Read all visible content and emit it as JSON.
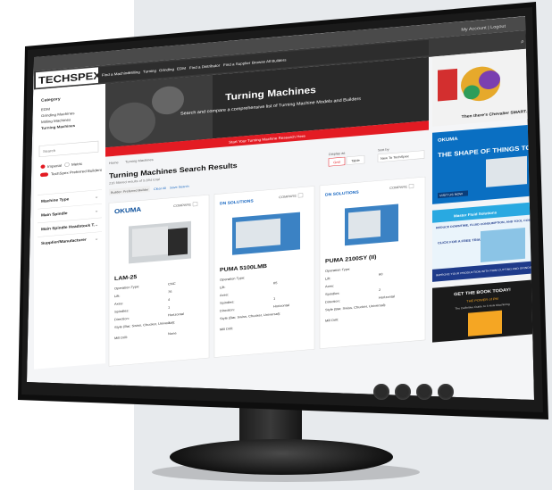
{
  "header": {
    "account_link": "My Account | Logout",
    "logo": "TECHSPEX",
    "nav": [
      "Find a Machine",
      "Milling",
      "Turning",
      "Grinding",
      "EDM",
      "Find a Distributor",
      "Find a Supplier",
      "Browse All Builders"
    ]
  },
  "sidebar": {
    "category_title": "Category",
    "categories": [
      "EDM",
      "Grinding Machines",
      "Milling Machines",
      "Turning Machines"
    ],
    "search_placeholder": "Search",
    "unit_imperial": "Imperial",
    "unit_metric": "Metric",
    "toggle_label": "TechSpex Preferred Builders",
    "filters": [
      "Machine Type",
      "Main Spindle",
      "Main Spindle Headstock T.",
      "Supplier/Manufacturer"
    ]
  },
  "hero": {
    "title": "Turning Machines",
    "subtitle": "Search and compare a comprehensive list of Turning Machine Models and Builders",
    "cta": "Start Your Turning Machine Research Here"
  },
  "breadcrumb": [
    "Home",
    "Turning Machines"
  ],
  "results": {
    "title": "Turning Machines Search Results",
    "count": "216 filtered results of 5,894 total",
    "chip": "Builder: Preferred Builder",
    "clear": "Clear All",
    "save": "Save Search",
    "display_label": "Display as",
    "grid": "Grid",
    "table": "Table",
    "sort_label": "Sort by",
    "sort_value": "New To TechSpex"
  },
  "cards": [
    {
      "brand": "OKUMA",
      "compare": "COMPARE",
      "name": "LAM-25",
      "rows": [
        [
          "Operation Type:",
          "CNC"
        ],
        [
          "Lift:",
          "76"
        ],
        [
          "Axes:",
          "4"
        ],
        [
          "Spindles:",
          "1"
        ],
        [
          "Direction:",
          "Horizontal"
        ],
        [
          "Style (Bar, Swiss, Chucker, Universal):",
          "2"
        ],
        [
          "Mill Drill:",
          "None"
        ]
      ]
    },
    {
      "brand": "DN SOLUTIONS",
      "compare": "COMPARE",
      "name": "PUMA 5100LMB",
      "rows": [
        [
          "Operation Type:",
          ""
        ],
        [
          "Lift:",
          "65"
        ],
        [
          "Axes:",
          ""
        ],
        [
          "Spindles:",
          "1"
        ],
        [
          "Direction:",
          "Horizontal"
        ],
        [
          "Style (Bar, Swiss, Chucker, Universal):",
          ""
        ],
        [
          "Mill Drill:",
          ""
        ]
      ]
    },
    {
      "brand": "DN SOLUTIONS",
      "compare": "COMPARE",
      "name": "PUMA 2100SY (II)",
      "rows": [
        [
          "Operation Type:",
          ""
        ],
        [
          "Lift:",
          "60"
        ],
        [
          "Axes:",
          ""
        ],
        [
          "Spindles:",
          "2"
        ],
        [
          "Direction:",
          "Horizontal"
        ],
        [
          "Style (Bar, Swiss, Chucker, Universal):",
          ""
        ],
        [
          "Mill Drill:",
          ""
        ]
      ]
    }
  ],
  "ads": {
    "ad1_caption": "Then there's Chevalier SMART.",
    "ad2_brand": "OKUMA",
    "ad2_headline": "THE SHAPE OF THINGS TO COME",
    "ad2_cta": "VISIT US NOW",
    "ad3_brand": "Master Fluid Solutions",
    "ad3_headline": "REDUCE DOWNTIME, FLUID CONSUMPTION, AND TOOL COSTS WITH TRIM® COOLANT",
    "ad3_side": "CLICK FOR A FREE TRIAL!",
    "ad3_footer": "IMPROVE YOUR PRODUCTION WITH TRIM CUTTING AND GRINDING FLUID",
    "ad4_headline": "GET THE BOOK TODAY!",
    "ad4_sub": "THE POWER of PM",
    "ad4_sub2": "The Definitive Guide to 5-Axis Machining",
    "ad4_spine": "MACHINING 5-AXIS"
  },
  "colors": {
    "brand_red": "#e31b23",
    "nav_dark": "#2d2d2d",
    "okuma_blue": "#0a4e9b",
    "dn_blue": "#1565c0"
  }
}
